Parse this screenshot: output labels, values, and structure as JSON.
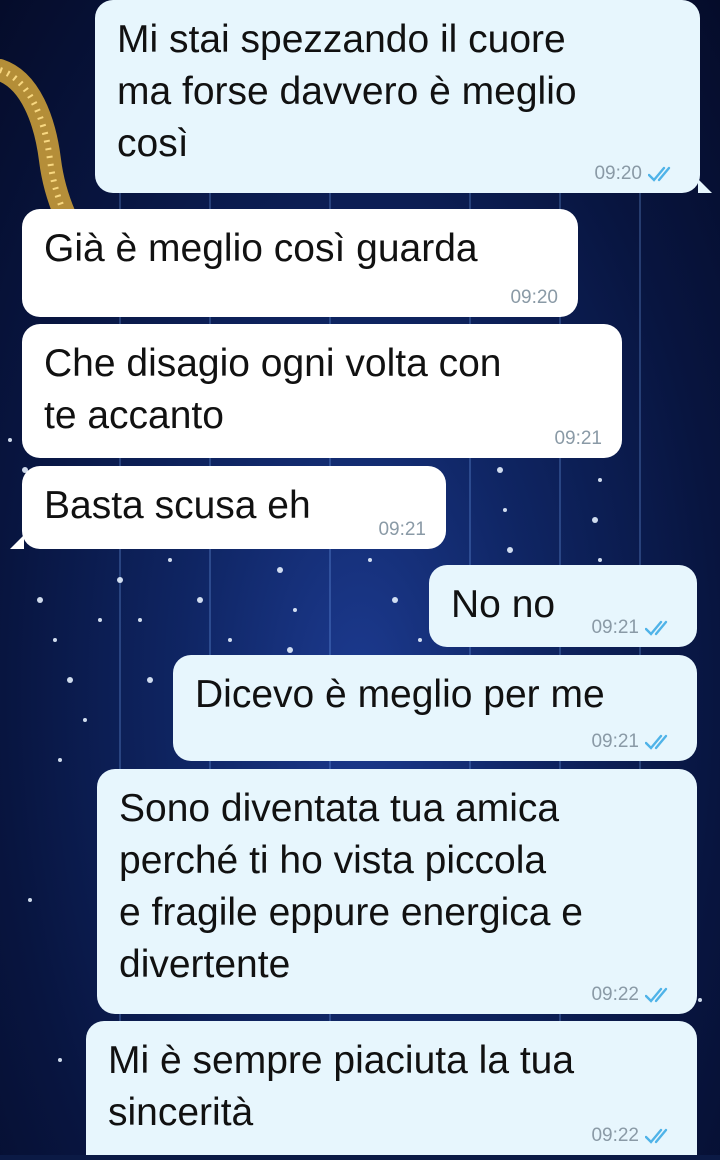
{
  "messages": [
    {
      "direction": "out",
      "text": "Mi stai spezzando il cuore\nma forse davvero è meglio\ncosì",
      "time": "09:20",
      "read": true
    },
    {
      "direction": "in",
      "text": "Già è meglio così guarda",
      "time": "09:20"
    },
    {
      "direction": "in",
      "text": "Che disagio ogni volta con\nte accanto",
      "time": "09:21"
    },
    {
      "direction": "in",
      "text": "Basta scusa eh",
      "time": "09:21"
    },
    {
      "direction": "out",
      "text": "No no",
      "time": "09:21",
      "read": true
    },
    {
      "direction": "out",
      "text": "Dicevo è meglio per me",
      "time": "09:21",
      "read": true
    },
    {
      "direction": "out",
      "text": "Sono diventata tua amica\nperché ti ho vista piccola\ne fragile eppure energica e\ndivertente",
      "time": "09:22",
      "read": true
    },
    {
      "direction": "out",
      "text": "Mi è sempre piaciuta la tua\nsincerità",
      "time": "09:22",
      "read": true
    }
  ],
  "colors": {
    "outgoing_bubble": "#e7f6fd",
    "incoming_bubble": "#ffffff",
    "read_ticks": "#4fb3e8",
    "timestamp": "#8a9aa6"
  },
  "icons": {
    "read_receipt": "double-check-icon",
    "wallpaper": "night-lights-wallpaper"
  }
}
